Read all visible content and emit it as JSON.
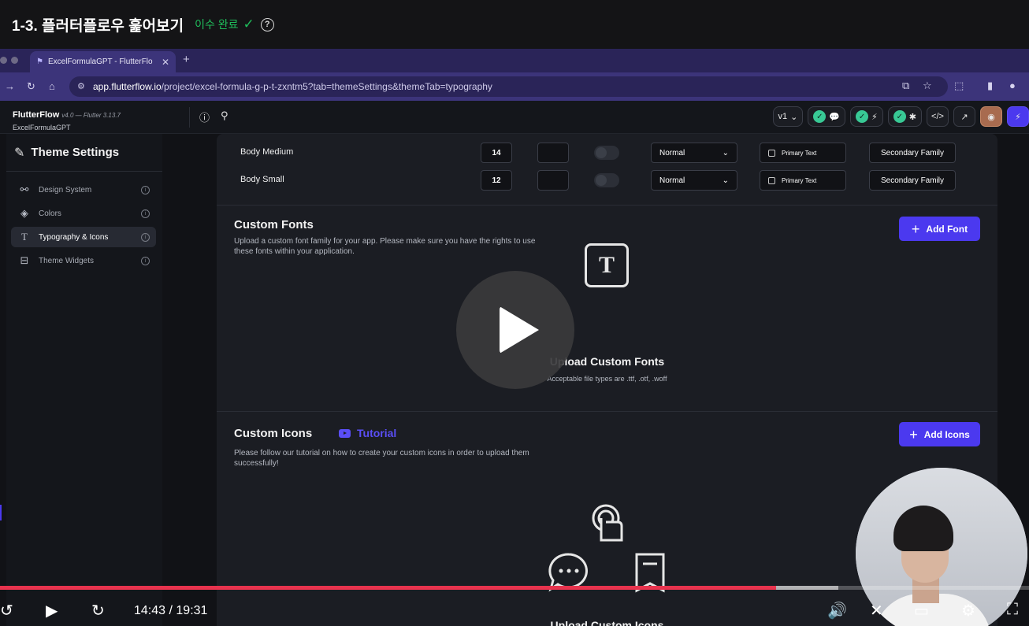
{
  "lecture": {
    "title": "1-3. 플러터플로우 훑어보기",
    "status": "이수 완료",
    "check": "✓",
    "help": "?"
  },
  "browser": {
    "tab_title": "ExcelFormulaGPT - FlutterFlo",
    "tab_close": "✕",
    "new_tab": "+",
    "url_host": "app.flutterflow.io",
    "url_path": "/project/excel-formula-g-p-t-zxntm5?tab=themeSettings&themeTab=typography"
  },
  "flutterflow": {
    "brand": "FlutterFlow",
    "version": "v4.0 — Flutter 3.13.7",
    "project": "ExcelFormulaGPT",
    "version_select": "v1"
  },
  "sidebar": {
    "title": "Theme Settings",
    "items": [
      {
        "label": "Design System",
        "icon": "design-system-icon"
      },
      {
        "label": "Colors",
        "icon": "colors-icon"
      },
      {
        "label": "Typography & Icons",
        "icon": "typography-icon"
      },
      {
        "label": "Theme Widgets",
        "icon": "widgets-icon"
      }
    ]
  },
  "typography_rows": [
    {
      "label": "Body Medium",
      "size": "14",
      "weight": "Normal",
      "color": "Primary Text",
      "family": "Secondary Family"
    },
    {
      "label": "Body Small",
      "size": "12",
      "weight": "Normal",
      "color": "Primary Text",
      "family": "Secondary Family"
    }
  ],
  "custom_fonts": {
    "title": "Custom Fonts",
    "description": "Upload a custom font family for your app. Please make sure you have the rights to use these fonts within your application.",
    "add_button": "Add Font",
    "upload_title": "Upload Custom Fonts",
    "upload_sub": "Acceptable file types are .ttf, .otf, .woff"
  },
  "custom_icons": {
    "title": "Custom Icons",
    "tutorial": "Tutorial",
    "description": "Please follow our tutorial on how to create your custom icons in order to upload them successfully!",
    "add_button": "Add Icons",
    "upload_title": "Upload Custom Icons"
  },
  "player": {
    "current_time": "14:43",
    "separator": "/",
    "duration": "19:31",
    "played_fraction": 0.754,
    "buffered_fraction": 0.815
  },
  "colors": {
    "accent": "#4b39ef",
    "progress": "#e8334e",
    "complete": "#1fbd5b"
  }
}
